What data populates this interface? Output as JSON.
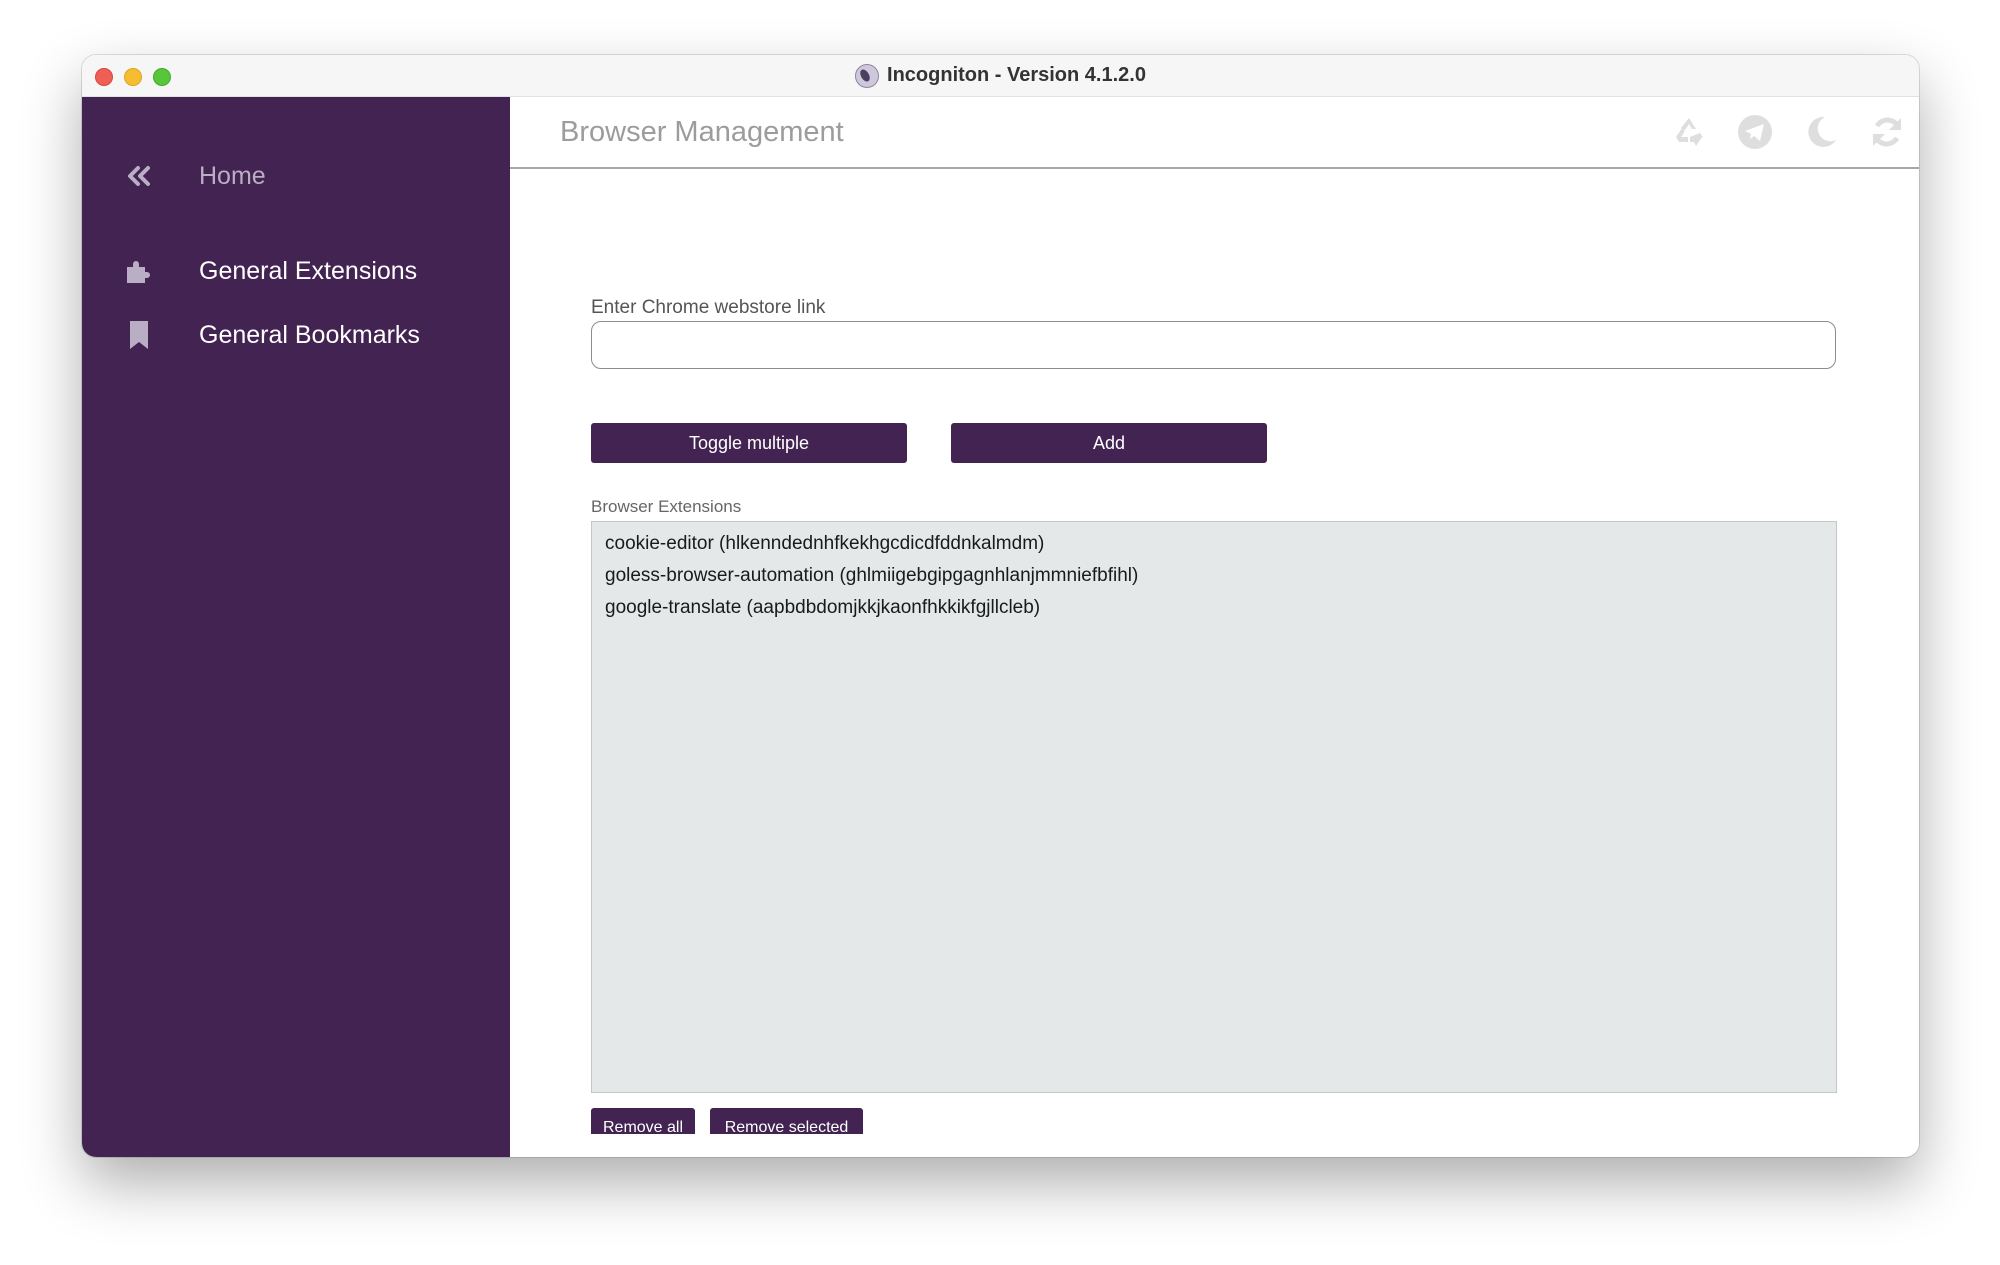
{
  "window": {
    "title": "Incogniton - Version 4.1.2.0"
  },
  "sidebar": {
    "home_label": "Home",
    "items": [
      {
        "label": "General Extensions",
        "icon": "puzzle-icon"
      },
      {
        "label": "General Bookmarks",
        "icon": "bookmark-icon"
      }
    ]
  },
  "header": {
    "title": "Browser Management",
    "icons": [
      "recycle-icon",
      "telegram-icon",
      "moon-icon",
      "refresh-icon",
      "logout-icon"
    ]
  },
  "form": {
    "webstore_label": "Enter Chrome webstore link",
    "webstore_value": "",
    "toggle_label": "Toggle multiple",
    "add_label": "Add"
  },
  "extensions": {
    "label": "Browser Extensions",
    "items": [
      "cookie-editor (hlkenndednhfkekhgcdicdfddnkalmdm)",
      "goless-browser-automation (ghlmiigebgipgagnhlanjmmniefbfihl)",
      "google-translate (aapbdbdomjkkjkaonfhkkikfgjllcleb)"
    ],
    "remove_all_label": "Remove all",
    "remove_selected_label": "Remove selected"
  },
  "colors": {
    "sidebar": "#432351",
    "button": "#432351",
    "list_background": "#e5e8e8"
  }
}
